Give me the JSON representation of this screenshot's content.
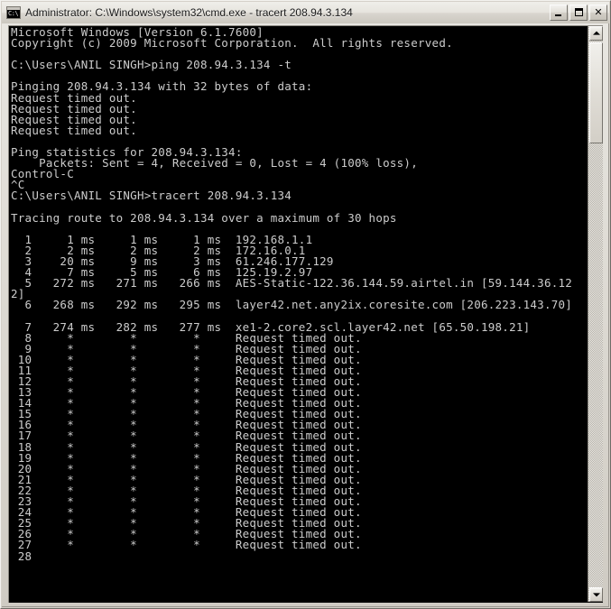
{
  "window": {
    "title": "Administrator: C:\\Windows\\system32\\cmd.exe - tracert  208.94.3.134",
    "icon_name": "cmd-icon",
    "icon_glyph": "C:\\",
    "controls": {
      "minimize_label": "Minimize",
      "maximize_label": "Maximize",
      "close_label": "Close",
      "close_glyph": "✕"
    },
    "colors": {
      "chrome": "#d4d0c8",
      "titlebar": "#e6e4de",
      "console_bg": "#000000",
      "console_fg": "#cccccc"
    }
  },
  "scrollbar": {
    "up_arrow_name": "scroll-up-arrow",
    "down_arrow_name": "scroll-down-arrow",
    "thumb_name": "scroll-thumb"
  },
  "console": {
    "prompt_user_path": "C:\\Users\\ANIL SINGH>",
    "commands": [
      "ping 208.94.3.134 -t",
      "tracert 208.94.3.134"
    ],
    "target_ip": "208.94.3.134",
    "header_lines": [
      "Microsoft Windows [Version 6.1.7600]",
      "Copyright (c) 2009 Microsoft Corporation.  All rights reserved."
    ],
    "ping_section": {
      "pinging_line": "Pinging 208.94.3.134 with 32 bytes of data:",
      "replies": [
        "Request timed out.",
        "Request timed out.",
        "Request timed out.",
        "Request timed out."
      ],
      "statistics_header": "Ping statistics for 208.94.3.134:",
      "statistics_line": "    Packets: Sent = 4, Received = 0, Lost = 4 (100% loss),",
      "interrupt_lines": [
        "Control-C",
        "^C"
      ],
      "sent": 4,
      "received": 0,
      "lost": 4,
      "loss_percent": "100%"
    },
    "tracert_section": {
      "tracing_line": "Tracing route to 208.94.3.134 over a maximum of 30 hops",
      "max_hops": 30,
      "hops": [
        {
          "hop": "1",
          "rtt1": "1 ms",
          "rtt2": "1 ms",
          "rtt3": "1 ms",
          "host": "192.168.1.1"
        },
        {
          "hop": "2",
          "rtt1": "2 ms",
          "rtt2": "2 ms",
          "rtt3": "2 ms",
          "host": "172.16.0.1"
        },
        {
          "hop": "3",
          "rtt1": "20 ms",
          "rtt2": "9 ms",
          "rtt3": "3 ms",
          "host": "61.246.177.129"
        },
        {
          "hop": "4",
          "rtt1": "7 ms",
          "rtt2": "5 ms",
          "rtt3": "6 ms",
          "host": "125.19.2.97"
        },
        {
          "hop": "5",
          "rtt1": "272 ms",
          "rtt2": "271 ms",
          "rtt3": "266 ms",
          "host": "AES-Static-122.36.144.59.airtel.in [59.144.36.122]"
        },
        {
          "hop": "6",
          "rtt1": "268 ms",
          "rtt2": "292 ms",
          "rtt3": "295 ms",
          "host": "layer42.net.any2ix.coresite.com [206.223.143.70]"
        },
        {
          "hop": "7",
          "rtt1": "274 ms",
          "rtt2": "282 ms",
          "rtt3": "277 ms",
          "host": "xe1-2.core2.scl.layer42.net [65.50.198.21]"
        },
        {
          "hop": "8",
          "rtt1": "*",
          "rtt2": "*",
          "rtt3": "*",
          "host": "Request timed out."
        },
        {
          "hop": "9",
          "rtt1": "*",
          "rtt2": "*",
          "rtt3": "*",
          "host": "Request timed out."
        },
        {
          "hop": "10",
          "rtt1": "*",
          "rtt2": "*",
          "rtt3": "*",
          "host": "Request timed out."
        },
        {
          "hop": "11",
          "rtt1": "*",
          "rtt2": "*",
          "rtt3": "*",
          "host": "Request timed out."
        },
        {
          "hop": "12",
          "rtt1": "*",
          "rtt2": "*",
          "rtt3": "*",
          "host": "Request timed out."
        },
        {
          "hop": "13",
          "rtt1": "*",
          "rtt2": "*",
          "rtt3": "*",
          "host": "Request timed out."
        },
        {
          "hop": "14",
          "rtt1": "*",
          "rtt2": "*",
          "rtt3": "*",
          "host": "Request timed out."
        },
        {
          "hop": "15",
          "rtt1": "*",
          "rtt2": "*",
          "rtt3": "*",
          "host": "Request timed out."
        },
        {
          "hop": "16",
          "rtt1": "*",
          "rtt2": "*",
          "rtt3": "*",
          "host": "Request timed out."
        },
        {
          "hop": "17",
          "rtt1": "*",
          "rtt2": "*",
          "rtt3": "*",
          "host": "Request timed out."
        },
        {
          "hop": "18",
          "rtt1": "*",
          "rtt2": "*",
          "rtt3": "*",
          "host": "Request timed out."
        },
        {
          "hop": "19",
          "rtt1": "*",
          "rtt2": "*",
          "rtt3": "*",
          "host": "Request timed out."
        },
        {
          "hop": "20",
          "rtt1": "*",
          "rtt2": "*",
          "rtt3": "*",
          "host": "Request timed out."
        },
        {
          "hop": "21",
          "rtt1": "*",
          "rtt2": "*",
          "rtt3": "*",
          "host": "Request timed out."
        },
        {
          "hop": "22",
          "rtt1": "*",
          "rtt2": "*",
          "rtt3": "*",
          "host": "Request timed out."
        },
        {
          "hop": "23",
          "rtt1": "*",
          "rtt2": "*",
          "rtt3": "*",
          "host": "Request timed out."
        },
        {
          "hop": "24",
          "rtt1": "*",
          "rtt2": "*",
          "rtt3": "*",
          "host": "Request timed out."
        },
        {
          "hop": "25",
          "rtt1": "*",
          "rtt2": "*",
          "rtt3": "*",
          "host": "Request timed out."
        },
        {
          "hop": "26",
          "rtt1": "*",
          "rtt2": "*",
          "rtt3": "*",
          "host": "Request timed out."
        },
        {
          "hop": "27",
          "rtt1": "*",
          "rtt2": "*",
          "rtt3": "*",
          "host": "Request timed out."
        },
        {
          "hop": "28",
          "rtt1": "",
          "rtt2": "",
          "rtt3": "",
          "host": ""
        }
      ]
    },
    "full_text": "Microsoft Windows [Version 6.1.7600]\nCopyright (c) 2009 Microsoft Corporation.  All rights reserved.\n\nC:\\Users\\ANIL SINGH>ping 208.94.3.134 -t\n\nPinging 208.94.3.134 with 32 bytes of data:\nRequest timed out.\nRequest timed out.\nRequest timed out.\nRequest timed out.\n\nPing statistics for 208.94.3.134:\n    Packets: Sent = 4, Received = 0, Lost = 4 (100% loss),\nControl-C\n^C\nC:\\Users\\ANIL SINGH>tracert 208.94.3.134\n\nTracing route to 208.94.3.134 over a maximum of 30 hops\n\n  1     1 ms     1 ms     1 ms  192.168.1.1\n  2     2 ms     2 ms     2 ms  172.16.0.1\n  3    20 ms     9 ms     3 ms  61.246.177.129\n  4     7 ms     5 ms     6 ms  125.19.2.97\n  5   272 ms   271 ms   266 ms  AES-Static-122.36.144.59.airtel.in [59.144.36.12\n2]\n  6   268 ms   292 ms   295 ms  layer42.net.any2ix.coresite.com [206.223.143.70]\n\n  7   274 ms   282 ms   277 ms  xe1-2.core2.scl.layer42.net [65.50.198.21]\n  8     *        *        *     Request timed out.\n  9     *        *        *     Request timed out.\n 10     *        *        *     Request timed out.\n 11     *        *        *     Request timed out.\n 12     *        *        *     Request timed out.\n 13     *        *        *     Request timed out.\n 14     *        *        *     Request timed out.\n 15     *        *        *     Request timed out.\n 16     *        *        *     Request timed out.\n 17     *        *        *     Request timed out.\n 18     *        *        *     Request timed out.\n 19     *        *        *     Request timed out.\n 20     *        *        *     Request timed out.\n 21     *        *        *     Request timed out.\n 22     *        *        *     Request timed out.\n 23     *        *        *     Request timed out.\n 24     *        *        *     Request timed out.\n 25     *        *        *     Request timed out.\n 26     *        *        *     Request timed out.\n 27     *        *        *     Request timed out.\n 28"
  }
}
